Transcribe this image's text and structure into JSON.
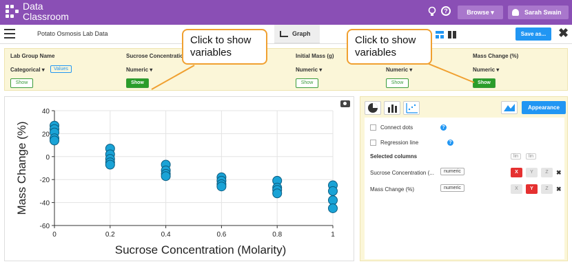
{
  "app": {
    "logo_line1": "Data",
    "logo_line2": "Classroom"
  },
  "topbar": {
    "browse_label": "Browse",
    "user_name": "Sarah Swain"
  },
  "document": {
    "title": "Potato Osmosis Lab Data",
    "graph_tab": "Graph",
    "save_label": "Save as...",
    "close_glyph": "✖"
  },
  "variables": [
    {
      "name": "Lab Group Name",
      "type": "Categorical",
      "values_label": "Values",
      "show_label": "Show",
      "show_active": false
    },
    {
      "name": "Sucrose Concentration",
      "type": "Numeric",
      "show_label": "Show",
      "show_active": true
    },
    {
      "name": "Initial Mass (g)",
      "type": "Numeric",
      "show_label": "Show",
      "show_active": false
    },
    {
      "name": "",
      "type": "Numeric",
      "show_label": "Show",
      "show_active": false
    },
    {
      "name": "Mass Change (%)",
      "type": "Numeric",
      "show_label": "Show",
      "show_active": true
    }
  ],
  "callouts": [
    "Click to show variables",
    "Click to show variables"
  ],
  "chart_data": {
    "type": "scatter",
    "xlabel": "Sucrose Concentration (Molarity)",
    "ylabel": "Mass Change (%)",
    "xlim": [
      0,
      1
    ],
    "ylim": [
      -60,
      40
    ],
    "xticks": [
      "0",
      "0.2",
      "0.4",
      "0.6",
      "0.8",
      "1"
    ],
    "yticks": [
      "40",
      "20",
      "0",
      "-20",
      "-40",
      "-60"
    ],
    "grid": true,
    "marker_color": "#1aa3d6",
    "series": [
      {
        "points": [
          [
            0,
            27
          ],
          [
            0,
            24
          ],
          [
            0,
            21
          ],
          [
            0,
            16
          ],
          [
            0,
            14
          ],
          [
            0.2,
            7
          ],
          [
            0.2,
            2
          ],
          [
            0.2,
            -2
          ],
          [
            0.2,
            -5
          ],
          [
            0.2,
            -7
          ],
          [
            0.4,
            -7
          ],
          [
            0.4,
            -12
          ],
          [
            0.4,
            -15
          ],
          [
            0.4,
            -17
          ],
          [
            0.6,
            -18
          ],
          [
            0.6,
            -21
          ],
          [
            0.6,
            -24
          ],
          [
            0.6,
            -26
          ],
          [
            0.8,
            -21
          ],
          [
            0.8,
            -27
          ],
          [
            0.8,
            -29
          ],
          [
            0.8,
            -32
          ],
          [
            1,
            -25
          ],
          [
            1,
            -30
          ],
          [
            1,
            -38
          ],
          [
            1,
            -45
          ]
        ]
      }
    ]
  },
  "side_panel": {
    "appearance_label": "Appearance",
    "connect_dots": "Connect dots",
    "regression_line": "Regression line",
    "selected_columns": "Selected columns",
    "lin_labels": [
      "lin",
      "lin"
    ],
    "columns": [
      {
        "name": "Sucrose Concentration (...",
        "type": "numeric",
        "axes": [
          "X",
          "Y",
          "Z"
        ],
        "active_axis": "X"
      },
      {
        "name": "Mass Change (%)",
        "type": "numeric",
        "axes": [
          "X",
          "Y",
          "Z"
        ],
        "active_axis": "Y"
      }
    ],
    "remove_glyph": "✖"
  },
  "colors": {
    "brand": "#8a4fb5",
    "accent": "#2196f3",
    "show_green": "#2a9d2a",
    "callout_border": "#f0a030",
    "axis_active": "#e53030"
  }
}
